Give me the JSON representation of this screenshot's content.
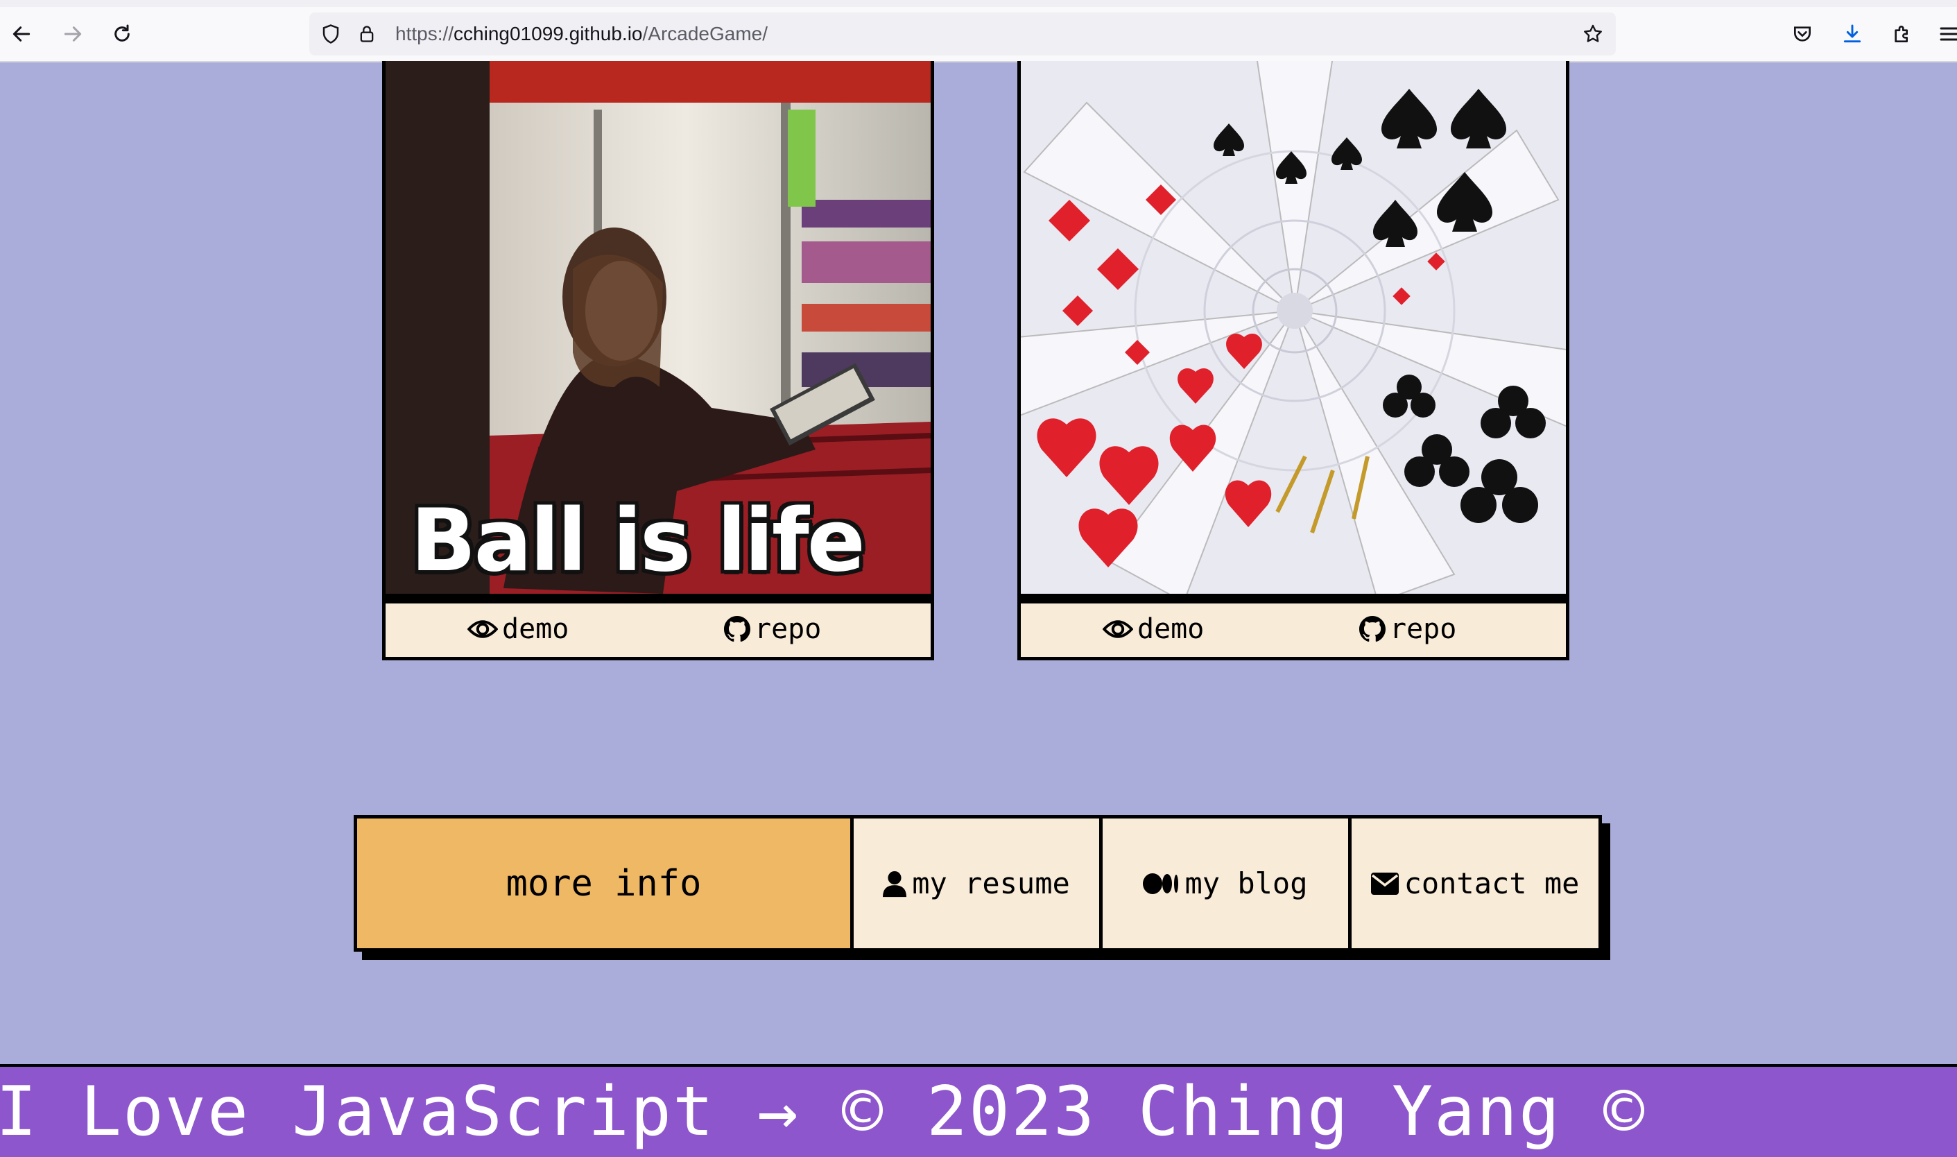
{
  "browser": {
    "url_prefix": "https://",
    "url_host": "cching01099.github.io",
    "url_path": "/ArcadeGame/"
  },
  "projects": [
    {
      "image_caption": "Ball is life",
      "demo_label": "demo",
      "repo_label": "repo"
    },
    {
      "demo_label": "demo",
      "repo_label": "repo"
    }
  ],
  "info_bar": {
    "more_info": "more info",
    "resume": "my resume",
    "blog": "my blog",
    "contact": "contact me"
  },
  "footer": {
    "marquee_text": "I Love JavaScript → © 2023 Ching Yang ©"
  },
  "colors": {
    "page_bg": "#aaadda",
    "card_bar": "#f8ebd8",
    "more_info_bg": "#eeb864",
    "footer_bg": "#8e56cd"
  },
  "icons": [
    "back-arrow-icon",
    "forward-arrow-icon",
    "reload-icon",
    "shield-icon",
    "lock-icon",
    "star-icon",
    "pocket-icon",
    "download-icon",
    "extensions-icon",
    "menu-icon",
    "eye-icon",
    "github-icon",
    "user-icon",
    "medium-icon",
    "envelope-icon"
  ]
}
